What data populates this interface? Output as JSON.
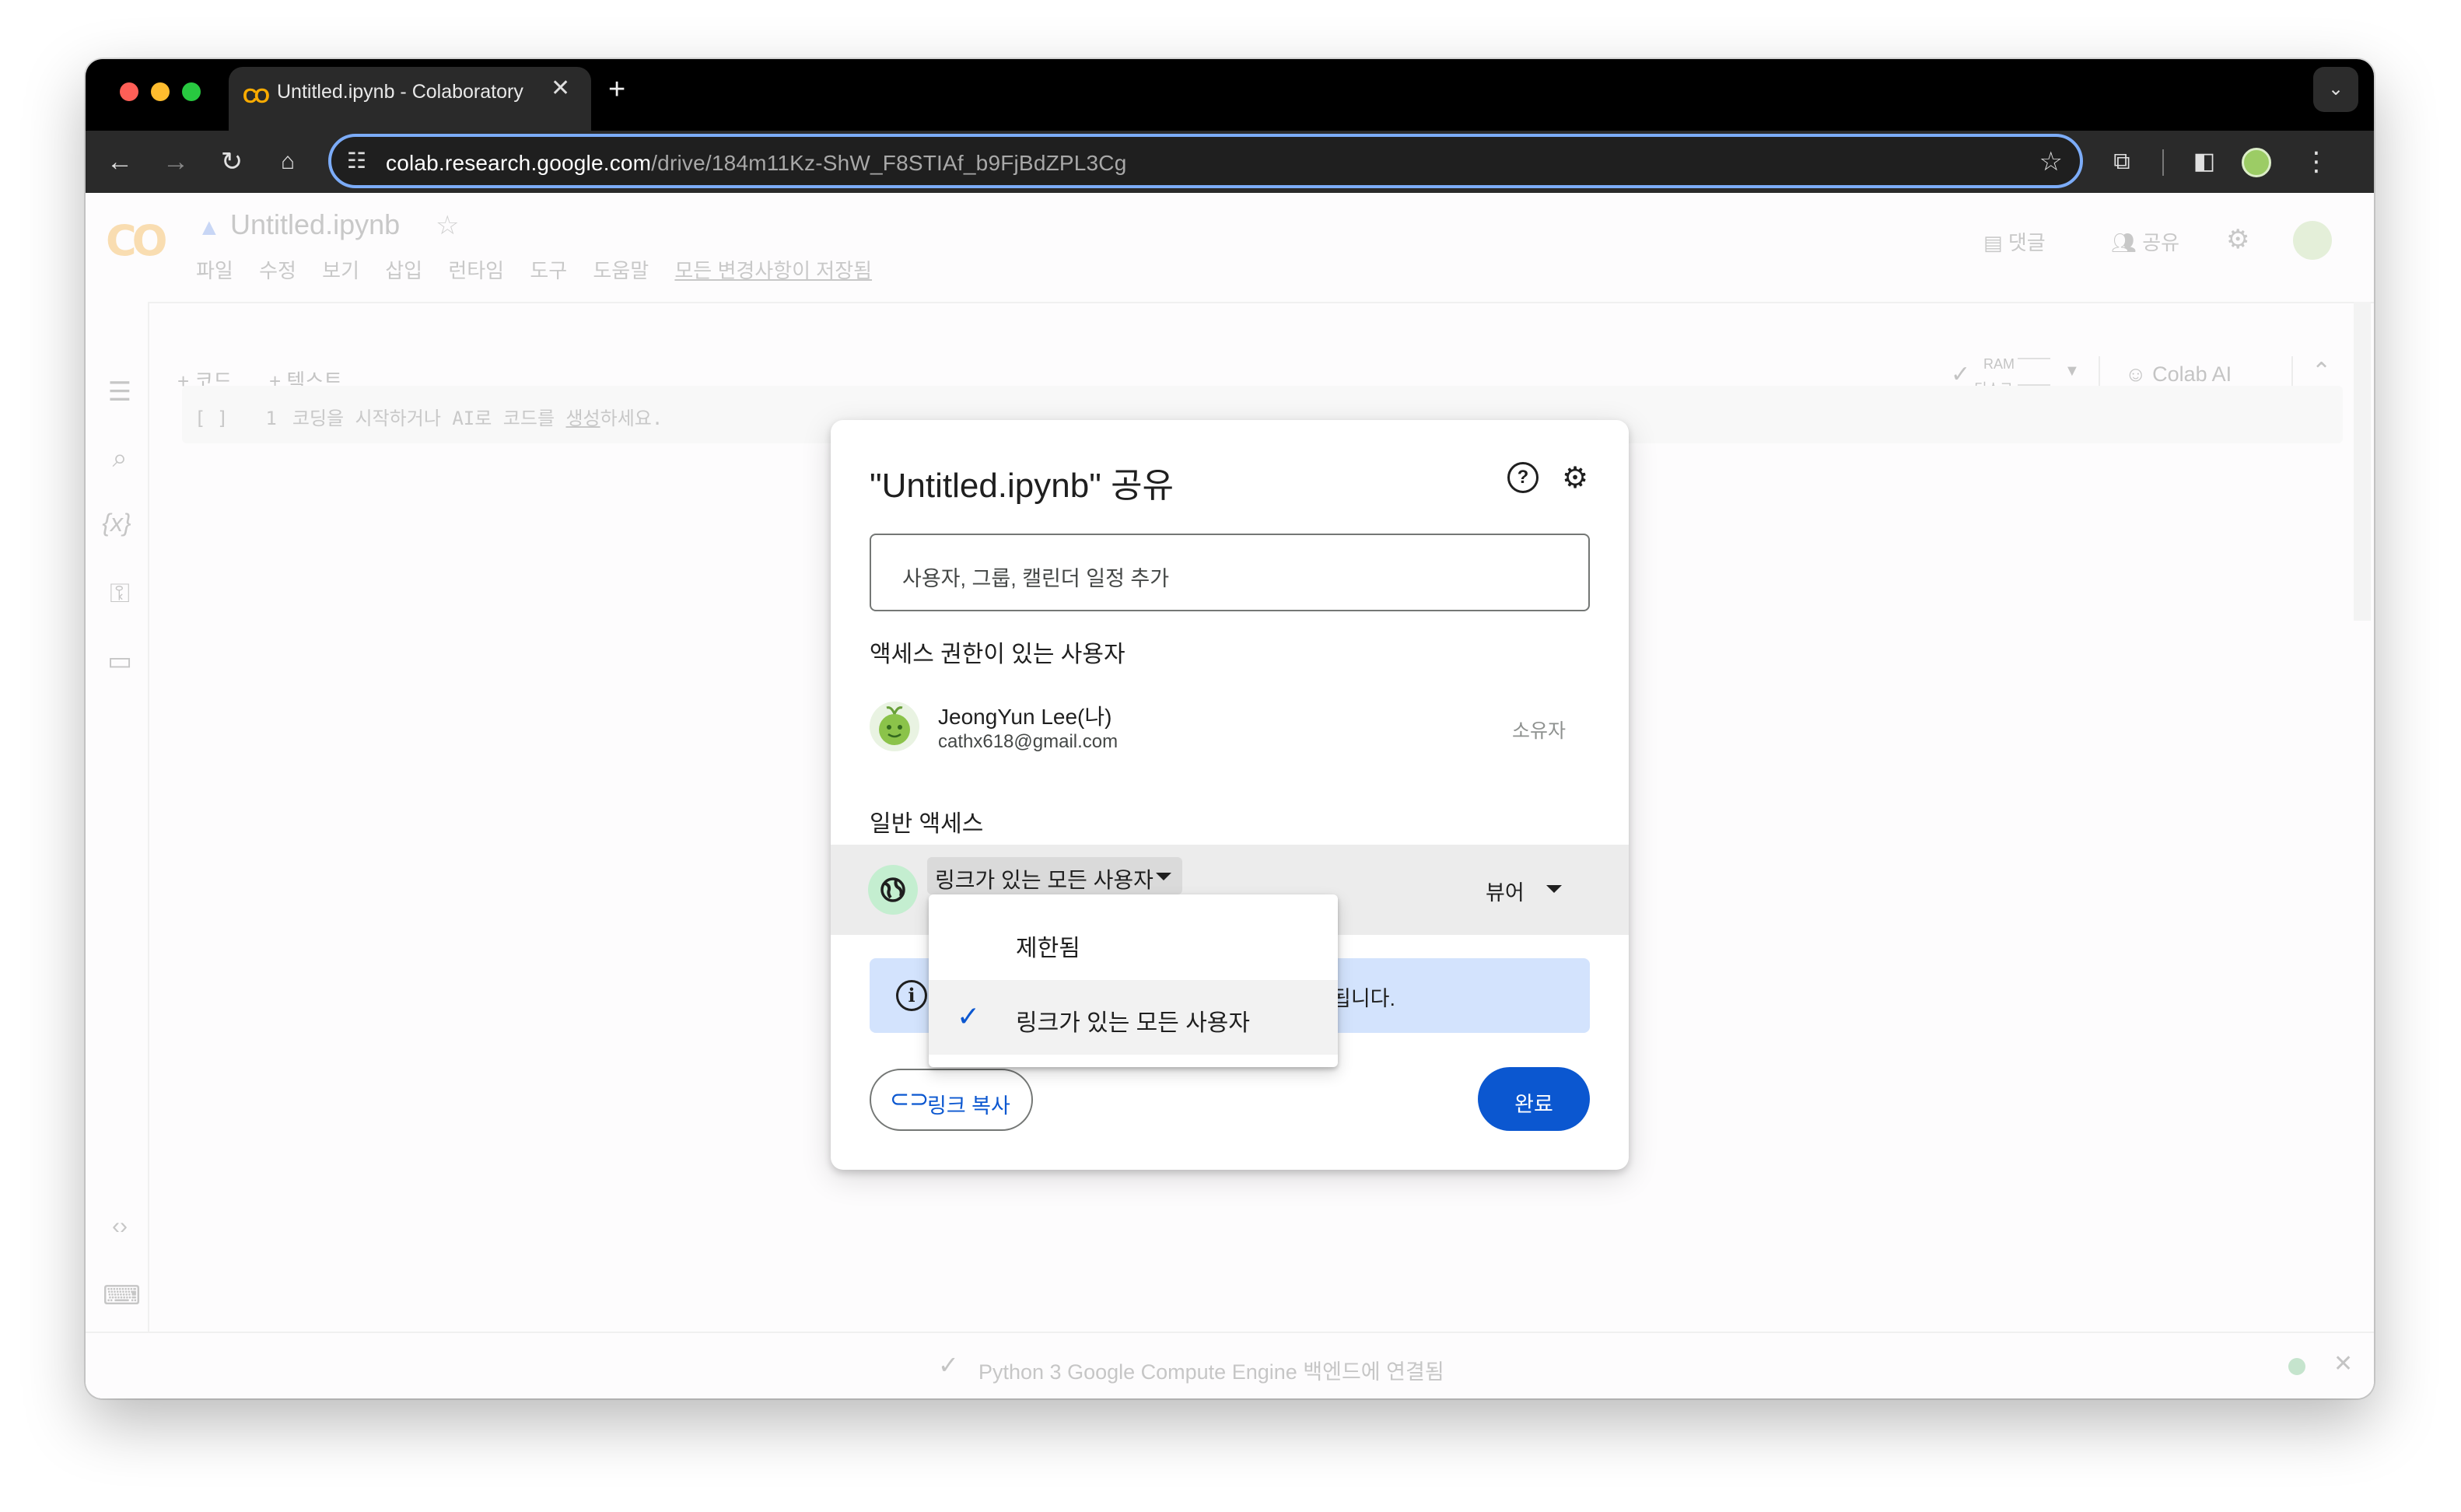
{
  "browser": {
    "tab_title": "Untitled.ipynb - Colaboratory",
    "url_host": "colab.research.google.com",
    "url_path": "/drive/184m11Kz-ShW_F8STIAf_b9FjBdZPL3Cg"
  },
  "colab": {
    "notebook_title": "Untitled.ipynb",
    "menu": [
      "파일",
      "수정",
      "보기",
      "삽입",
      "런타임",
      "도구",
      "도움말"
    ],
    "saved_status": "모든 변경사항이 저장됨",
    "comments_label": "댓글",
    "share_label": "공유",
    "add_code": "+ 코드",
    "add_text": "+ 텍스트",
    "ram_label": "RAM",
    "disk_label": "디스크",
    "colab_ai_label": "Colab AI",
    "cell_bracket": "[ ]",
    "cell_line_number": "1",
    "cell_placeholder_pre": "코딩을 시작하거나 AI로 코드를 ",
    "cell_placeholder_link": "생성",
    "cell_placeholder_post": "하세요.",
    "status_text": "Python 3 Google Compute Engine 백엔드에 연결됨"
  },
  "dialog": {
    "title": "\"Untitled.ipynb\" 공유",
    "add_placeholder": "사용자, 그룹, 캘린더 일정 추가",
    "people_section": "액세스 권한이 있는 사용자",
    "user_name": "JeongYun Lee(나)",
    "user_email": "cathx618@gmail.com",
    "user_role": "소유자",
    "general_section": "일반 액세스",
    "access_value": "링크가 있는 모든 사용자",
    "role_value": "뷰어",
    "info_text": "됩니다.",
    "copy_link": "링크 복사",
    "done": "완료"
  },
  "dropdown": {
    "options": [
      "제한됨",
      "링크가 있는 모든 사용자"
    ],
    "selected": "링크가 있는 모든 사용자"
  },
  "colors": {
    "primary_blue": "#0b57d0",
    "info_bg": "#d3e3fd",
    "omnibox_focus": "#7cacf8"
  }
}
